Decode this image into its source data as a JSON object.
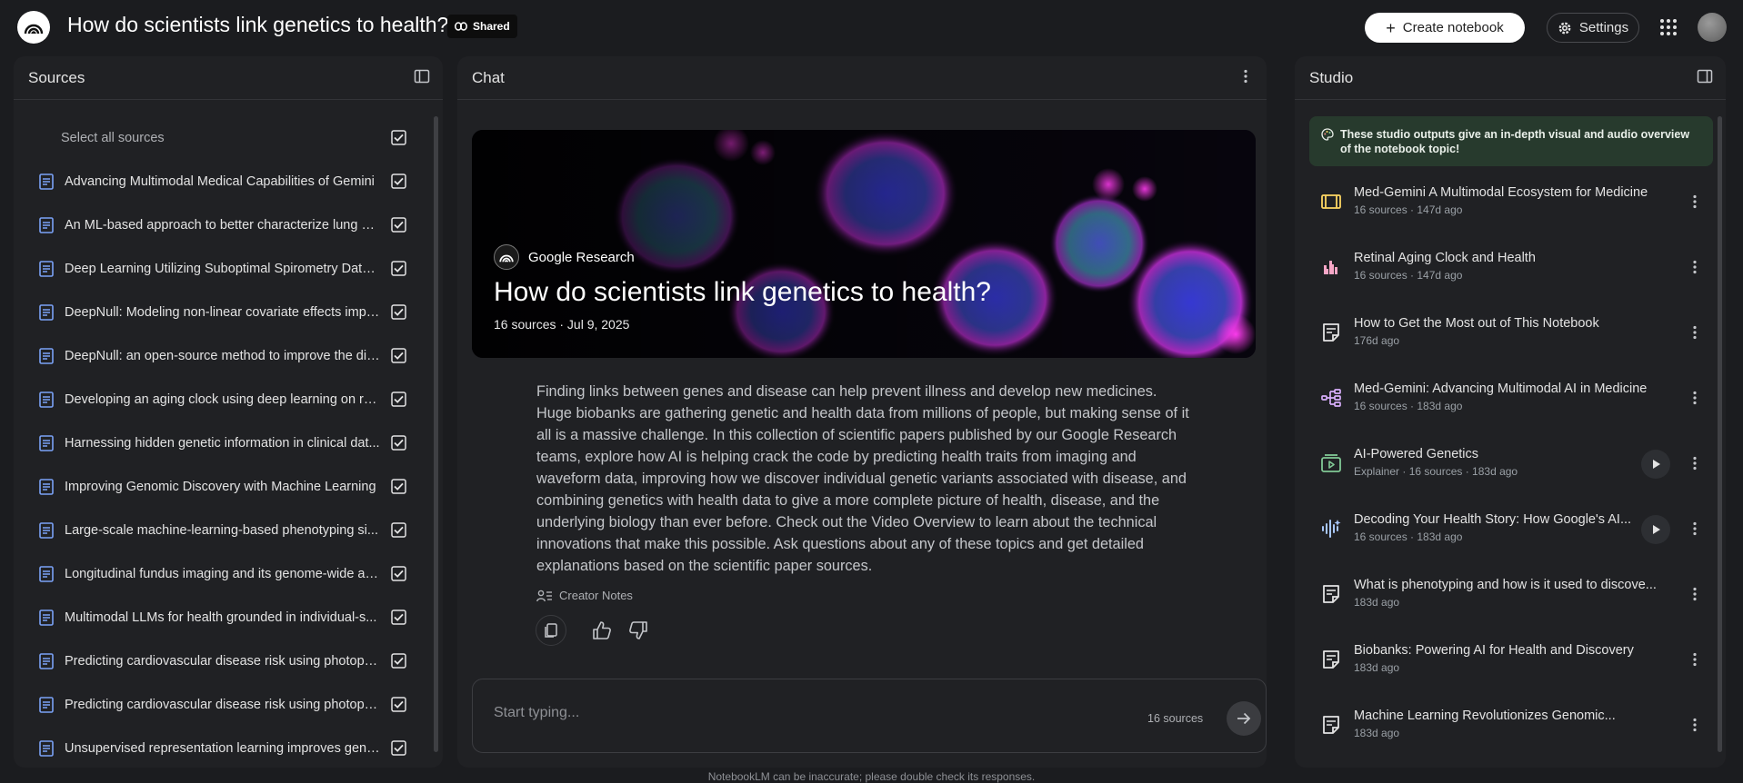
{
  "header": {
    "title": "How do scientists link genetics to health?",
    "shared_label": "Shared",
    "create_label": "Create notebook",
    "settings_label": "Settings"
  },
  "sources": {
    "title": "Sources",
    "select_all": "Select all sources",
    "items": [
      "Advancing Multimodal Medical Capabilities of Gemini",
      "An ML-based approach to better characterize lung di...",
      "Deep Learning Utilizing Suboptimal Spirometry Data t...",
      "DeepNull: Modeling non-linear covariate effects impr...",
      "DeepNull: an open-source method to improve the dis...",
      "Developing an aging clock using deep learning on ret...",
      "Harnessing hidden genetic information in clinical dat...",
      "Improving Genomic Discovery with Machine Learning",
      "Large-scale machine-learning-based phenotyping si...",
      "Longitudinal fundus imaging and its genome-wide as...",
      "Multimodal LLMs for health grounded in individual-s...",
      "Predicting cardiovascular disease risk using photople...",
      "Predicting cardiovascular disease risk using photople...",
      "Unsupervised representation learning improves geno..."
    ]
  },
  "chat": {
    "title": "Chat",
    "hero": {
      "source": "Google Research",
      "title": "How do scientists link genetics to health?",
      "meta": "16 sources · Jul 9, 2025"
    },
    "summary": "Finding links between genes and disease can help prevent illness and develop new medicines. Huge biobanks are gathering genetic and health data from millions of people, but making sense of it all is a massive challenge. In this collection of scientific papers published by our Google Research teams, explore how AI is helping crack the code by predicting health traits from imaging and waveform data, improving how we discover individual genetic variants associated with disease, and combining genetics with health data to give a more complete picture of health, disease, and the underlying biology than ever before. Check out the Video Overview to learn about the technical innovations that make this possible. Ask questions about any of these topics and get detailed explanations based on the scientific paper sources.",
    "creator_notes": "Creator Notes",
    "input_placeholder": "Start typing...",
    "input_count": "16 sources"
  },
  "studio": {
    "title": "Studio",
    "notice": "These studio outputs give an in-depth visual and audio overview of the notebook topic!",
    "items": [
      {
        "icon": "slides-icon",
        "title": "Med-Gemini A Multimodal Ecosystem for Medicine",
        "meta": "16 sources · 147d ago",
        "play": false
      },
      {
        "icon": "bar-chart-icon",
        "title": "Retinal Aging Clock and Health",
        "meta": "16 sources · 147d ago",
        "play": false
      },
      {
        "icon": "note-icon",
        "title": "How to Get the Most out of This Notebook",
        "meta": "176d ago",
        "play": false
      },
      {
        "icon": "mind-map-icon",
        "title": "Med-Gemini: Advancing Multimodal AI in Medicine",
        "meta": "16 sources · 183d ago",
        "play": false
      },
      {
        "icon": "video-icon",
        "title": "AI-Powered Genetics",
        "meta": "Explainer · 16 sources · 183d ago",
        "play": true
      },
      {
        "icon": "audio-wave-icon",
        "title": "Decoding Your Health Story: How Google's AI...",
        "meta": "16 sources · 183d ago",
        "play": true
      },
      {
        "icon": "note-icon",
        "title": "What is phenotyping and how is it used to discove...",
        "meta": "183d ago",
        "play": false
      },
      {
        "icon": "note-icon",
        "title": "Biobanks: Powering AI for Health and Discovery",
        "meta": "183d ago",
        "play": false
      },
      {
        "icon": "note-icon",
        "title": "Machine Learning Revolutionizes Genomic...",
        "meta": "183d ago",
        "play": false
      }
    ]
  },
  "footer": "NotebookLM can be inaccurate; please double check its responses."
}
